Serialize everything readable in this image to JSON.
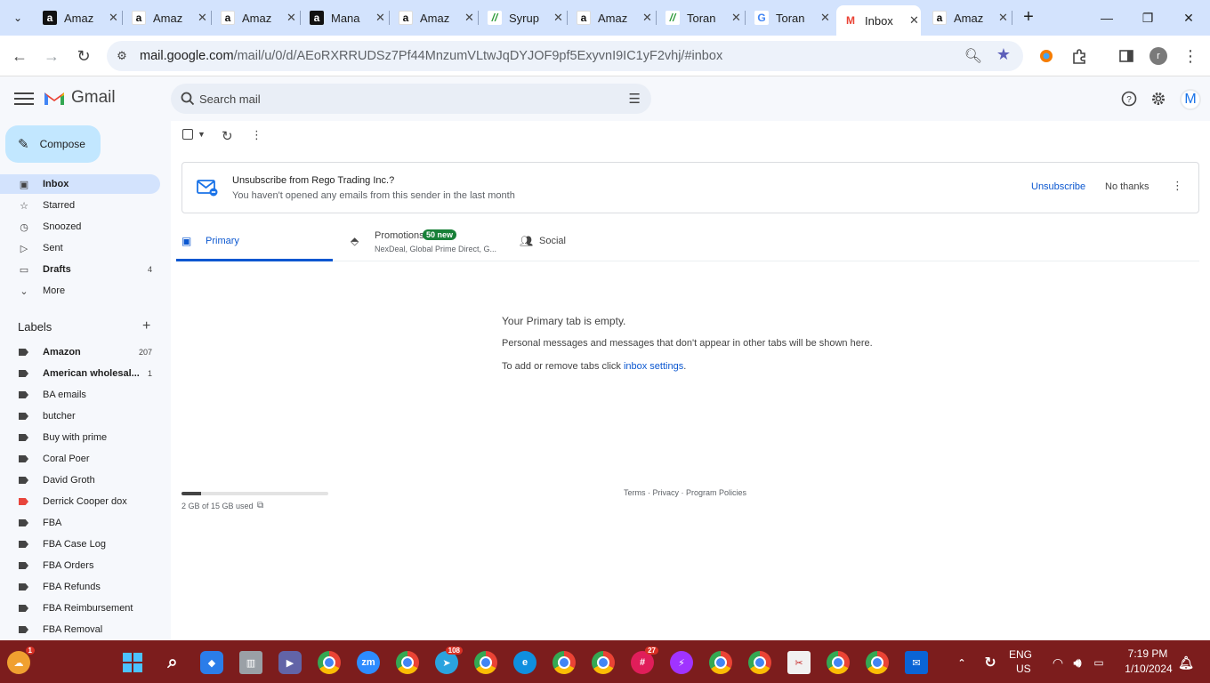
{
  "browser": {
    "tabs": [
      {
        "title": "Amaz",
        "favicon": "amazon-icon"
      },
      {
        "title": "Amaz",
        "favicon": "amazon-icon"
      },
      {
        "title": "Amaz",
        "favicon": "amazon-icon"
      },
      {
        "title": "Mana",
        "favicon": "amazon-icon"
      },
      {
        "title": "Amaz",
        "favicon": "amazon-icon"
      },
      {
        "title": "Syrup",
        "favicon": "syrup-icon"
      },
      {
        "title": "Amaz",
        "favicon": "amazon-icon"
      },
      {
        "title": "Toran",
        "favicon": "syrup-icon"
      },
      {
        "title": "Toran",
        "favicon": "google-icon"
      },
      {
        "title": "Inbox",
        "favicon": "gmail-icon",
        "active": true
      },
      {
        "title": "Amaz",
        "favicon": "amazon-icon"
      }
    ],
    "url_host": "mail.google.com",
    "url_path": "/mail/u/0/d/AEoRXRRUDSz7Pf44MnzumVLtwJqDYJOF9pf5ExyvnI9IC1yF2vhj/#inbox",
    "profile_initial": "r"
  },
  "gmail": {
    "logo_text": "Gmail",
    "search_placeholder": "Search mail",
    "account_initial": "M",
    "compose_label": "Compose",
    "nav": [
      {
        "label": "Inbox",
        "icon": "inbox-icon",
        "count": "",
        "active": true
      },
      {
        "label": "Starred",
        "icon": "star-icon",
        "count": ""
      },
      {
        "label": "Snoozed",
        "icon": "clock-icon",
        "count": ""
      },
      {
        "label": "Sent",
        "icon": "send-icon",
        "count": ""
      },
      {
        "label": "Drafts",
        "icon": "draft-icon",
        "count": "4",
        "bold": true
      },
      {
        "label": "More",
        "icon": "chevron-down-icon",
        "count": ""
      }
    ],
    "labels_title": "Labels",
    "labels": [
      {
        "name": "Amazon",
        "count": "207",
        "bold": true
      },
      {
        "name": "American wholesal...",
        "count": "1",
        "bold": true
      },
      {
        "name": "BA emails",
        "count": ""
      },
      {
        "name": "butcher",
        "count": ""
      },
      {
        "name": "Buy with prime",
        "count": ""
      },
      {
        "name": "Coral Poer",
        "count": ""
      },
      {
        "name": "David Groth",
        "count": ""
      },
      {
        "name": "Derrick Cooper dox",
        "count": "",
        "color": "#e8453c"
      },
      {
        "name": "FBA",
        "count": ""
      },
      {
        "name": "FBA Case Log",
        "count": ""
      },
      {
        "name": "FBA Orders",
        "count": ""
      },
      {
        "name": "FBA Refunds",
        "count": ""
      },
      {
        "name": "FBA Reimbursement",
        "count": ""
      },
      {
        "name": "FBA Removal",
        "count": ""
      }
    ],
    "unsubscribe": {
      "title": "Unsubscribe from Rego Trading Inc.?",
      "subtitle": "You haven't opened any emails from this sender in the last month",
      "unsubscribe_label": "Unsubscribe",
      "no_thanks_label": "No thanks"
    },
    "categories": {
      "primary": "Primary",
      "promotions": "Promotions",
      "promotions_badge": "50 new",
      "promotions_senders": "NexDeal, Global Prime Direct, G...",
      "social": "Social"
    },
    "empty_state": {
      "title": "Your Primary tab is empty.",
      "line1": "Personal messages and messages that don't appear in other tabs will be shown here.",
      "line2_prefix": "To add or remove tabs click ",
      "line2_link": "inbox settings",
      "line2_suffix": "."
    },
    "storage": {
      "text": "2 GB of 15 GB used",
      "fraction": 0.133
    },
    "footer": "Terms · Privacy · Program Policies"
  },
  "taskbar": {
    "notification_badge": "1",
    "telegram_badge": "108",
    "slack_badge": "27",
    "language": "ENG",
    "region": "US",
    "time": "7:19 PM",
    "date": "1/10/2024"
  },
  "colors": {
    "tabstrip": "#d3e3fd",
    "gmail_bg": "#f6f8fc",
    "compose": "#c2e7ff",
    "active_nav": "#d3e3fd",
    "link_blue": "#0b57d0",
    "badge_green": "#188038",
    "taskbar": "#7c1d1d"
  }
}
